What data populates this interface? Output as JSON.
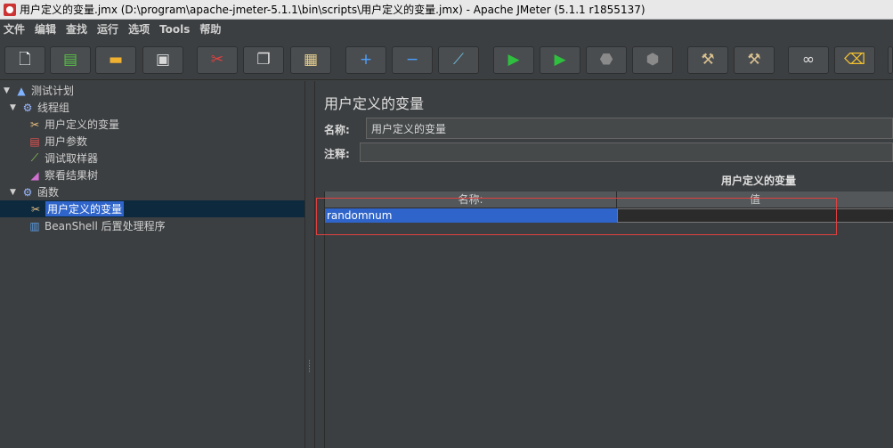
{
  "window": {
    "title": "用户定义的变量.jmx (D:\\program\\apache-jmeter-5.1.1\\bin\\scripts\\用户定义的变量.jmx) - Apache JMeter (5.1.1 r1855137)"
  },
  "menu": [
    "文件",
    "编辑",
    "查找",
    "运行",
    "选项",
    "Tools",
    "帮助"
  ],
  "toolbar": {
    "buttons": [
      {
        "name": "new",
        "icon": "new-file-icon",
        "glyph": "🗋",
        "color": "#ffffff"
      },
      {
        "name": "templates",
        "icon": "templates-icon",
        "glyph": "▤",
        "color": "#58c048"
      },
      {
        "name": "open",
        "icon": "open-folder-icon",
        "glyph": "▬",
        "color": "#f0b030"
      },
      {
        "name": "save",
        "icon": "save-icon",
        "glyph": "▣",
        "color": "#d8d8d8"
      },
      {
        "name": "cut",
        "icon": "cut-icon",
        "glyph": "✂",
        "color": "#e04040"
      },
      {
        "name": "copy",
        "icon": "copy-icon",
        "glyph": "❐",
        "color": "#e0e0e0"
      },
      {
        "name": "paste",
        "icon": "paste-icon",
        "glyph": "▦",
        "color": "#e8d090"
      },
      {
        "name": "expand",
        "icon": "plus-icon",
        "glyph": "+",
        "color": "#4aa0ff"
      },
      {
        "name": "collapse",
        "icon": "minus-icon",
        "glyph": "−",
        "color": "#4aa0ff"
      },
      {
        "name": "toggle",
        "icon": "toggle-wand-icon",
        "glyph": "⟋",
        "color": "#70c0e0"
      },
      {
        "name": "start",
        "icon": "play-icon",
        "glyph": "▶",
        "color": "#2fbf3f"
      },
      {
        "name": "start-no-pause",
        "icon": "play-no-pause-icon",
        "glyph": "▶",
        "color": "#2fbf3f"
      },
      {
        "name": "stop",
        "icon": "stop-icon",
        "glyph": "⬣",
        "color": "#8a8a8a"
      },
      {
        "name": "shutdown",
        "icon": "shutdown-icon",
        "glyph": "⬢",
        "color": "#8a8a8a"
      },
      {
        "name": "clear",
        "icon": "clear-broom-icon",
        "glyph": "⚒",
        "color": "#d8c090"
      },
      {
        "name": "clear-all",
        "icon": "clear-all-broom-icon",
        "glyph": "⚒",
        "color": "#d8c090"
      },
      {
        "name": "search",
        "icon": "binoculars-icon",
        "glyph": "∞",
        "color": "#e0e0e0"
      },
      {
        "name": "reset-search",
        "icon": "reset-search-broom-icon",
        "glyph": "⌫",
        "color": "#f0c030"
      }
    ]
  },
  "tree": {
    "items": [
      {
        "label": "测试计划",
        "icon": "test-plan-flask-icon",
        "glyph": "▲",
        "color": "#7fb2ff",
        "arrow": "▼"
      },
      {
        "label": "线程组",
        "icon": "thread-group-gear-icon",
        "glyph": "⚙",
        "color": "#9ab8ff",
        "arrow": "▼"
      },
      {
        "label": "用户定义的变量",
        "icon": "config-tools-icon",
        "glyph": "✂",
        "color": "#e8c080",
        "arrow": ""
      },
      {
        "label": "用户参数",
        "icon": "user-parameters-icon",
        "glyph": "▤",
        "color": "#e05050",
        "arrow": ""
      },
      {
        "label": "调试取样器",
        "icon": "debug-sampler-pipette-icon",
        "glyph": "⟋",
        "color": "#90d060",
        "arrow": ""
      },
      {
        "label": "察看结果树",
        "icon": "results-tree-chart-icon",
        "glyph": "◢",
        "color": "#d070d0",
        "arrow": ""
      },
      {
        "label": "函数",
        "icon": "thread-group-gear-icon",
        "glyph": "⚙",
        "color": "#9ab8ff",
        "arrow": "▼"
      },
      {
        "label": "用户定义的变量",
        "icon": "config-tools-icon",
        "glyph": "✂",
        "color": "#e8c080",
        "arrow": "",
        "selected": true
      },
      {
        "label": "BeanShell 后置处理程序",
        "icon": "beanshell-script-icon",
        "glyph": "▥",
        "color": "#5a9ae0",
        "arrow": ""
      }
    ]
  },
  "panel": {
    "title": "用户定义的变量",
    "name_label": "名称:",
    "name_value": "用户定义的变量",
    "comment_label": "注释:",
    "comment_value": "",
    "table_title": "用户定义的变量",
    "columns": [
      "名称:",
      "值"
    ],
    "rows": [
      {
        "name": "randomnum",
        "value": ""
      }
    ]
  },
  "colors": {
    "background": "#3c3f41",
    "selection": "#2f65ca",
    "highlight_box": "#e04040"
  }
}
